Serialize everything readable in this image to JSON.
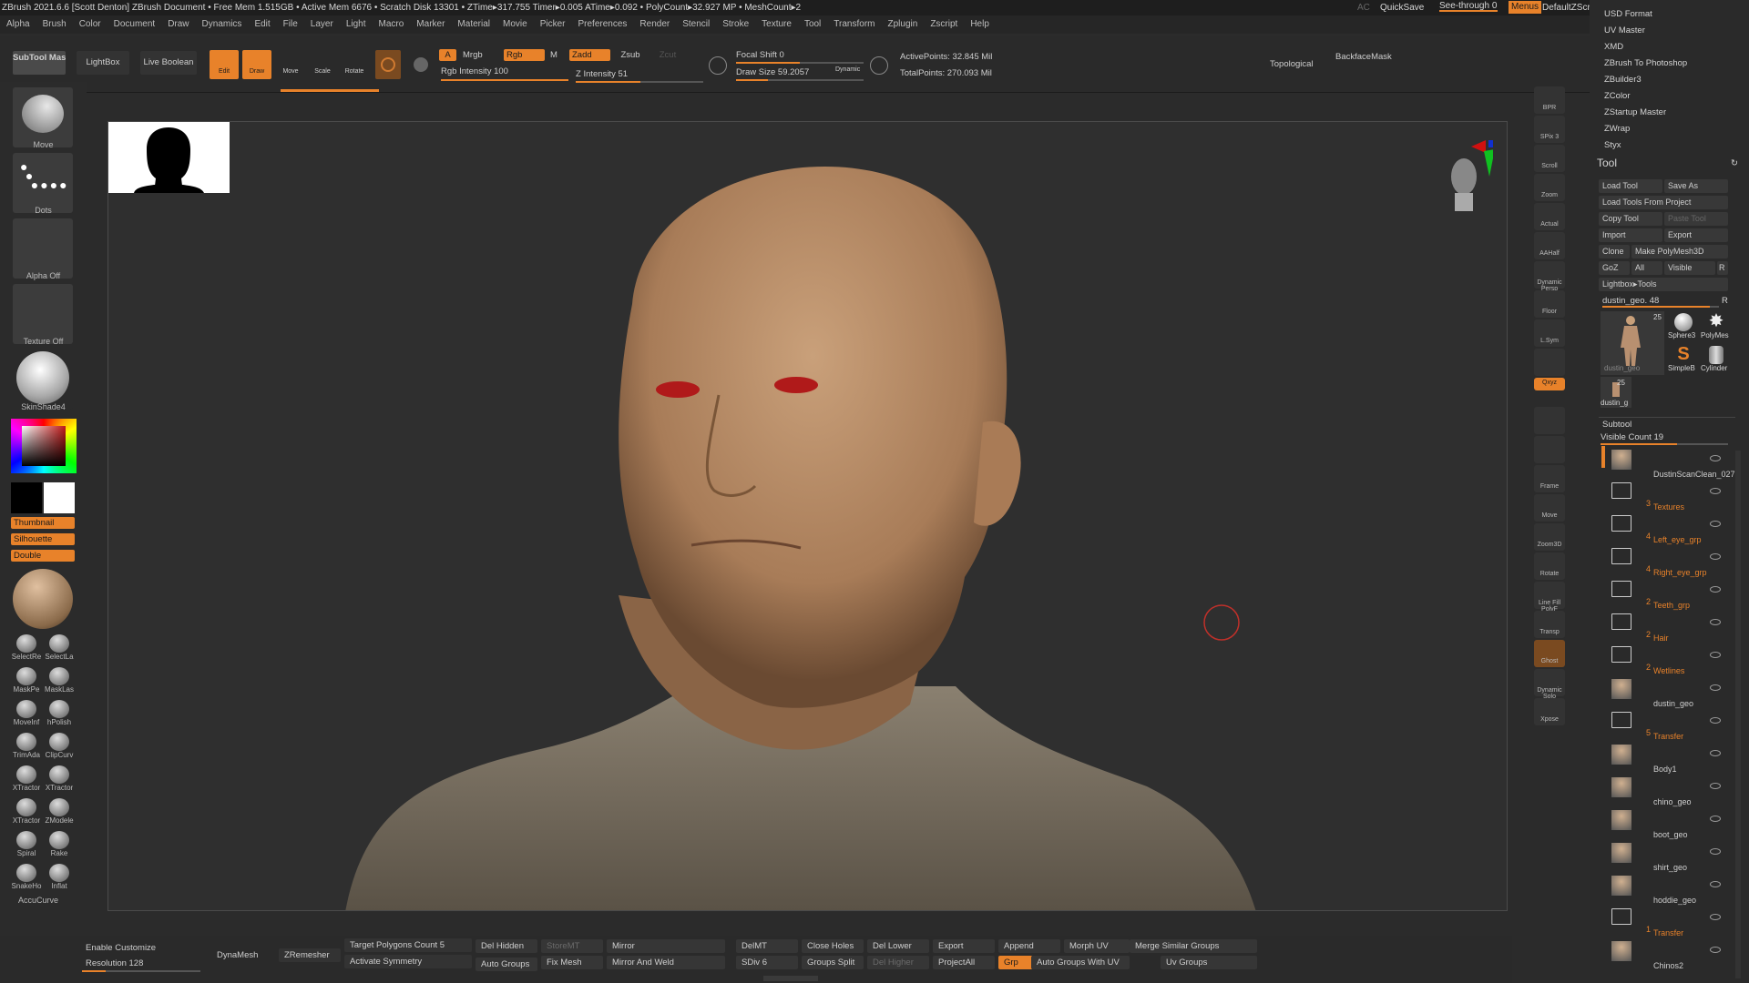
{
  "title_bar": {
    "text": "ZBrush 2021.6.6 [Scott Denton]   ZBrush Document     • Free Mem 1.515GB • Active Mem 6676 • Scratch Disk 13301 •  ZTime▸317.755 Timer▸0.005 ATime▸0.092 • PolyCount▸32.927 MP  • MeshCount▸2",
    "ac": "AC",
    "quicksave": "QuickSave",
    "see_through": "See-through  0",
    "menus": "Menus",
    "default_zscript": "DefaultZScript"
  },
  "menu": [
    "Alpha",
    "Brush",
    "Color",
    "Document",
    "Draw",
    "Dynamics",
    "Edit",
    "File",
    "Layer",
    "Light",
    "Macro",
    "Marker",
    "Material",
    "Movie",
    "Picker",
    "Preferences",
    "Render",
    "Stencil",
    "Stroke",
    "Texture",
    "Tool",
    "Transform",
    "Zplugin",
    "Zscript",
    "Help"
  ],
  "toolbar": {
    "subtool_master": "SubTool Master",
    "lightbox": "LightBox",
    "live_boolean": "Live Boolean",
    "edit": "Edit",
    "draw": "Draw",
    "move": "Move",
    "scale": "Scale",
    "rotate": "Rotate",
    "a": "A",
    "mrgb": "Mrgb",
    "rgb": "Rgb",
    "m": "M",
    "zadd": "Zadd",
    "zsub": "Zsub",
    "zcut": "Zcut",
    "rgb_intensity": "Rgb Intensity 100",
    "rgb_intensity_value": 100,
    "z_intensity": "Z Intensity 51",
    "z_intensity_value": 51,
    "focal_shift": "Focal Shift 0",
    "draw_size": "Draw Size 59.2057",
    "dynamic": "Dynamic",
    "active_points": "ActivePoints: 32.845 Mil",
    "total_points": "TotalPoints: 270.093 Mil",
    "topological": "Topological",
    "backface_mask": "BackfaceMask"
  },
  "left_panel": {
    "brush_label": "Move",
    "stroke_label": "Dots",
    "alpha_label": "Alpha Off",
    "texture_label": "Texture Off",
    "material_label": "SkinShade4",
    "thumbnail": "Thumbnail",
    "silhouette": "Silhouette",
    "double": "Double",
    "brushes": [
      {
        "a": "SelectRe",
        "b": "SelectLa"
      },
      {
        "a": "MaskPe",
        "b": "MaskLas"
      },
      {
        "a": "MoveInf",
        "b": "hPolish"
      },
      {
        "a": "TrimAda",
        "b": "ClipCurv"
      },
      {
        "a": "XTractor",
        "b": "XTractor"
      },
      {
        "a": "XTractor",
        "b": "ZModele"
      },
      {
        "a": "Spiral",
        "b": "Rake"
      },
      {
        "a": "SnakeHo",
        "b": "Inflat"
      }
    ],
    "accucurve": "AccuCurve"
  },
  "right_shelf": [
    "BPR",
    "SPix 3",
    "Scroll",
    "Zoom",
    "Actual",
    "AAHalf",
    "Dynamic Persp",
    "Floor",
    "L.Sym",
    "",
    "Qxyz",
    "",
    "",
    "Frame",
    "Move",
    "Zoom3D",
    "Rotate",
    "Line Fill PolyF",
    "Transp",
    "Ghost",
    "Dynamic Solo",
    "Xpose"
  ],
  "right_panel": {
    "top_list": [
      "USD Format",
      "UV Master",
      "XMD",
      "ZBrush To Photoshop",
      "ZBuilder3",
      "ZColor",
      "ZStartup Master",
      "ZWrap",
      "Styx"
    ],
    "tool_title": "Tool",
    "load_tool": "Load Tool",
    "save_as": "Save As",
    "load_tools_from_project": "Load Tools From Project",
    "copy_tool": "Copy Tool",
    "paste_tool": "Paste Tool",
    "import": "Import",
    "export": "Export",
    "clone": "Clone",
    "make_polymesh3d": "Make PolyMesh3D",
    "goz": "GoZ",
    "all": "All",
    "visible": "Visible",
    "r": "R",
    "lightbox_tools": "Lightbox▸Tools",
    "current_tool": "dustin_geo. 48",
    "tools": [
      "dustin_geo",
      "Sphere3",
      "PolyMes",
      "SimpleB",
      "Cylinder",
      "dustin_g"
    ],
    "tool_count": "25",
    "subtool_title": "Subtool",
    "visible_count": "Visible Count 19",
    "subtools": [
      {
        "num": "",
        "name": "DustinScanClean_027",
        "type": "mesh"
      },
      {
        "num": "3",
        "name": "Textures",
        "type": "folder"
      },
      {
        "num": "4",
        "name": "Left_eye_grp",
        "type": "folder"
      },
      {
        "num": "4",
        "name": "Right_eye_grp",
        "type": "folder"
      },
      {
        "num": "2",
        "name": "Teeth_grp",
        "type": "folder"
      },
      {
        "num": "2",
        "name": "Hair",
        "type": "folder"
      },
      {
        "num": "2",
        "name": "Wetlines",
        "type": "folder"
      },
      {
        "num": "",
        "name": "dustin_geo",
        "type": "mesh"
      },
      {
        "num": "5",
        "name": "Transfer",
        "type": "folder"
      },
      {
        "num": "",
        "name": "Body1",
        "type": "mesh"
      },
      {
        "num": "",
        "name": "chino_geo",
        "type": "mesh"
      },
      {
        "num": "",
        "name": "boot_geo",
        "type": "mesh"
      },
      {
        "num": "",
        "name": "shirt_geo",
        "type": "mesh"
      },
      {
        "num": "",
        "name": "hoddie_geo",
        "type": "mesh"
      },
      {
        "num": "1",
        "name": "Transfer",
        "type": "folder"
      },
      {
        "num": "",
        "name": "Chinos2",
        "type": "mesh"
      }
    ]
  },
  "bottom_bar": {
    "enable_customize": "Enable Customize",
    "resolution": "Resolution 128",
    "dynamesh": "DynaMesh",
    "zremesher": "ZRemesher",
    "target_polygons": "Target Polygons Count 5",
    "activate_symmetry": "Activate Symmetry",
    "del_hidden": "Del Hidden",
    "storemt": "StoreMT",
    "auto_groups": "Auto Groups",
    "fix_mesh": "Fix Mesh",
    "mirror": "Mirror",
    "mirror_and_weld": "Mirror And Weld",
    "delmt": "DelMT",
    "sdiv": "SDiv 6",
    "close_holes": "Close Holes",
    "groups_split": "Groups Split",
    "del_lower": "Del Lower",
    "del_higher": "Del Higher",
    "export": "Export",
    "projectall": "ProjectAll",
    "append": "Append",
    "grp": "Grp",
    "morph_uv": "Morph UV",
    "auto_groups_with_uv": "Auto Groups With UV",
    "merge_similar_groups": "Merge Similar Groups",
    "uv_groups": "Uv Groups"
  },
  "colors": {
    "accent": "#e8822a",
    "bg": "#2b2b2b",
    "panel": "#2a2a2a"
  }
}
